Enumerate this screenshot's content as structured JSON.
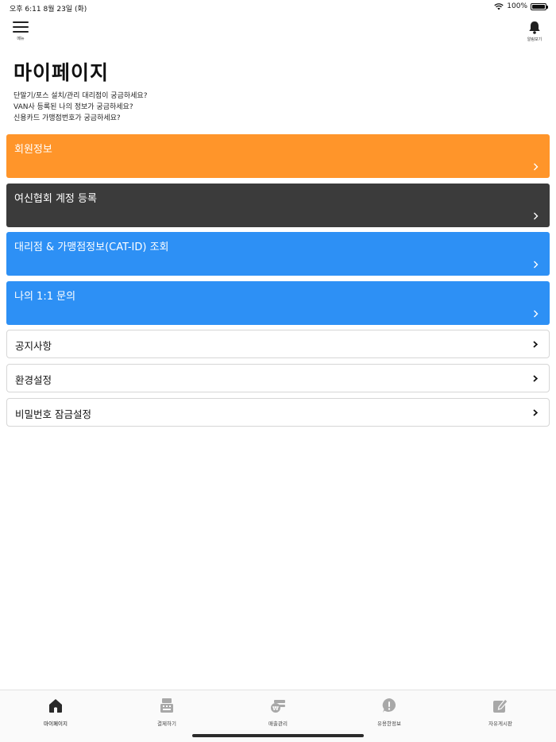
{
  "status": {
    "time_date": "오후 6:11   8월 23일 (화)",
    "battery": "100%",
    "battery_level": 1.0
  },
  "top_bar": {
    "menu_label": "메뉴",
    "alarm_label": "알림보기"
  },
  "header": {
    "title": "마이페이지",
    "desc": [
      "단말기/포스 설치/관리 대리점이 궁금하세요?",
      "VAN사 등록된 나의 정보가 궁금하세요?",
      "신용카드 가맹점번호가 궁금하세요?"
    ]
  },
  "cards": [
    {
      "label": "회원정보",
      "color": "#ff952a"
    },
    {
      "label": "여신협회 계정 등록",
      "color": "#3b3b3b"
    },
    {
      "label": "대리점 & 가맹점정보(CAT-ID) 조회",
      "color": "#2d90f5"
    },
    {
      "label": "나의 1:1 문의",
      "color": "#2d90f5"
    }
  ],
  "list": [
    {
      "label": "공지사항"
    },
    {
      "label": "환경설정"
    },
    {
      "label": "비밀번호 잠금설정"
    }
  ],
  "tabs": [
    {
      "label": "마이페이지",
      "icon": "home-icon",
      "active": true
    },
    {
      "label": "결제하기",
      "icon": "cash-register-icon",
      "active": false
    },
    {
      "label": "매출관리",
      "icon": "sales-wallet-icon",
      "active": false
    },
    {
      "label": "유용한정보",
      "icon": "info-bubble-icon",
      "active": false
    },
    {
      "label": "자유게시판",
      "icon": "edit-board-icon",
      "active": false
    }
  ],
  "colors": {
    "active_tab": "#2a2a2a",
    "inactive_tab": "#a8a8a8"
  }
}
